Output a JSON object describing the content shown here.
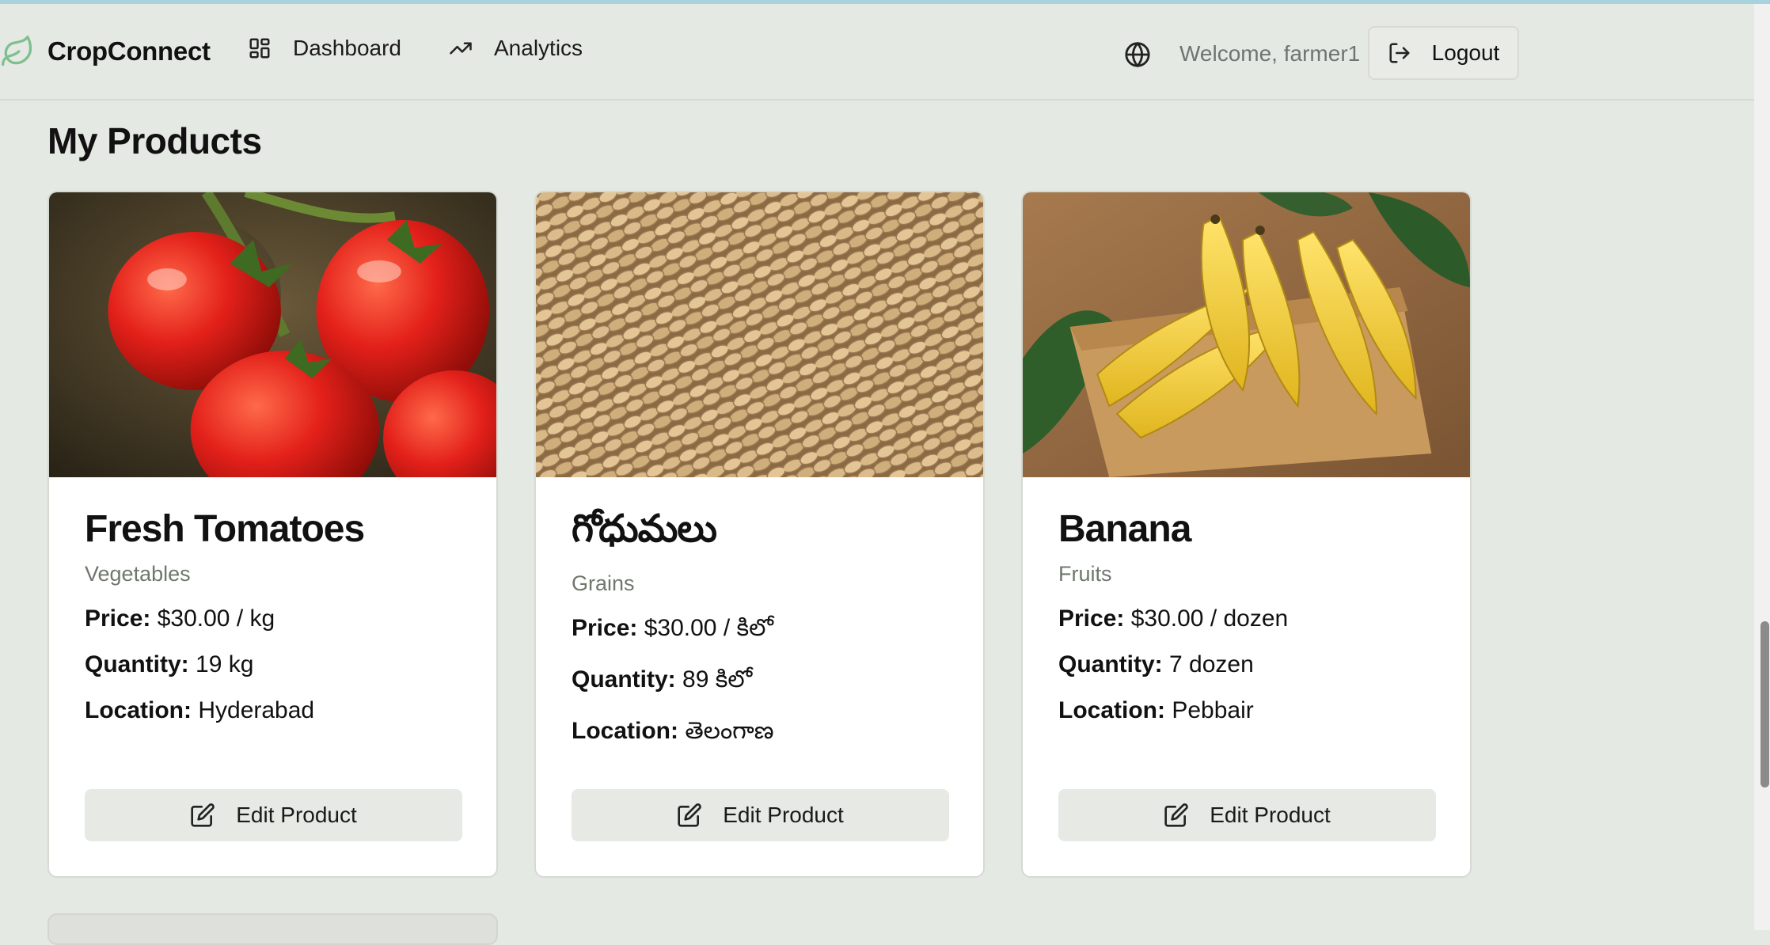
{
  "app": {
    "name": "CropConnect"
  },
  "nav": {
    "dashboard_label": "Dashboard",
    "analytics_label": "Analytics",
    "welcome_text": "Welcome, farmer1",
    "logout_label": "Logout"
  },
  "page": {
    "title": "My Products"
  },
  "labels": {
    "price": "Price:",
    "quantity": "Quantity:",
    "location": "Location:",
    "edit_button": "Edit Product"
  },
  "products": [
    {
      "name": "Fresh Tomatoes",
      "category": "Vegetables",
      "price": "$30.00 / kg",
      "quantity": "19 kg",
      "location": "Hyderabad",
      "image": "tomatoes-photo"
    },
    {
      "name": "గోధుమలు",
      "category": "Grains",
      "price": "$30.00 / కిలో",
      "quantity": "89 కిలో",
      "location": "తెలంగాణ",
      "image": "wheat-grains-photo"
    },
    {
      "name": "Banana",
      "category": "Fruits",
      "price": "$30.00 / dozen",
      "quantity": "7 dozen",
      "location": "Pebbair",
      "image": "bananas-basket-photo"
    }
  ],
  "colors": {
    "background": "#e5e9e3",
    "card": "#ffffff",
    "button": "#e6e9e4",
    "muted_text": "#6f786d"
  }
}
